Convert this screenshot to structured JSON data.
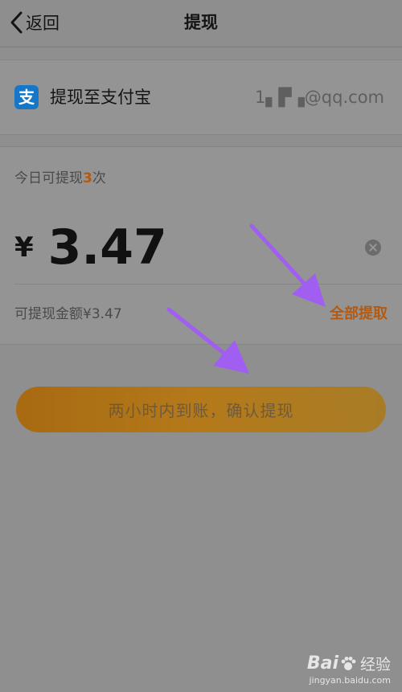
{
  "navbar": {
    "back_label": "返回",
    "title": "提现"
  },
  "target": {
    "icon": "alipay-icon",
    "icon_glyph": "支",
    "label": "提现至支付宝",
    "account": "1▖▛▗@qq.com"
  },
  "amount": {
    "limit_prefix": "今日可提现",
    "limit_count": "3",
    "limit_suffix": "次",
    "currency": "¥",
    "value": "3.47",
    "available": "可提现金额¥3.47",
    "withdraw_all": "全部提取"
  },
  "confirm": {
    "label": "两小时内到账，确认提现"
  },
  "watermark": {
    "brand": "Bai",
    "brand_suffix": "经验",
    "url": "jingyan.baidu.com"
  },
  "colors": {
    "accent": "#b45a10",
    "arrow": "#a05ff0",
    "alipay_blue": "#1677c8"
  }
}
